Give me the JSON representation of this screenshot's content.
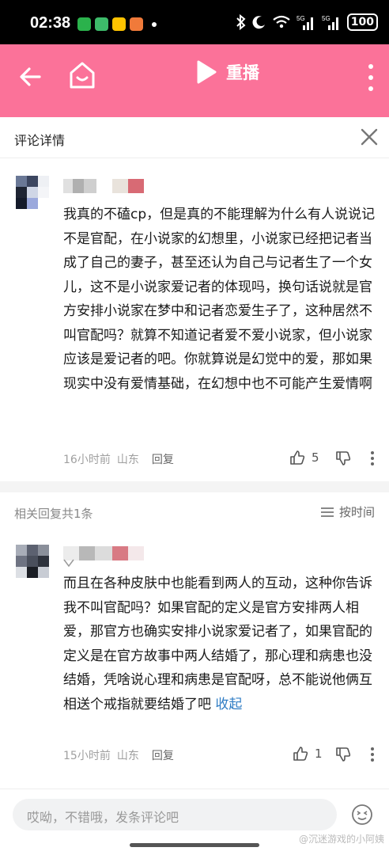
{
  "status_bar": {
    "time": "02:38",
    "battery": "100",
    "signal1": "5G",
    "signal2": "5G"
  },
  "topbar": {
    "replay_label": "重播"
  },
  "detail": {
    "title": "评论详情"
  },
  "main_comment": {
    "text": "我真的不磕cp，但是真的不能理解为什么有人说说记不是官配，在小说家的幻想里，小说家已经把记者当成了自己的妻子，甚至还认为自己与记者生了一个女儿，这不是小说家爱记者的体现吗，换句话说就是官方安排小说家在梦中和记者恋爱生子了，这种居然不叫官配吗？就算不知道记者爱不爱小说家，但小说家应该是爱记者的吧。你就算说是幻觉中的爱，那如果现实中没有爱情基础，在幻想中也不可能产生爱情啊",
    "time": "16小时前",
    "location": "山东",
    "reply_label": "回复",
    "likes": "5"
  },
  "replies": {
    "count_label": "相关回复共1条",
    "sort_label": "按时间",
    "items": [
      {
        "text": "而且在各种皮肤中也能看到两人的互动，这种你告诉我不叫官配吗？如果官配的定义是官方安排两人相爱，那官方也确实安排小说家爱记者了，如果官配的定义是在官方故事中两人结婚了，那心理和病患也没结婚，凭啥说心理和病患是官配呀，总不能说他俩互相送个戒指就要结婚了吧",
        "collapse_label": "收起",
        "time": "15小时前",
        "location": "山东",
        "reply_label": "回复",
        "likes": "1"
      }
    ]
  },
  "bottom": {
    "input_placeholder": "哎呦，不错哦，发条评论吧",
    "watermark": "@沉迷游戏的小阿姨"
  },
  "colors": {
    "brand_pink": "#fb7299",
    "link_blue": "#2e7cc4"
  }
}
